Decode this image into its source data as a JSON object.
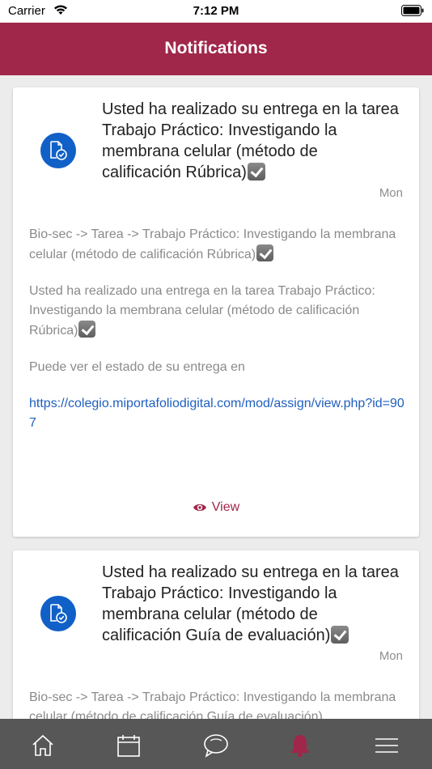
{
  "status_bar": {
    "carrier": "Carrier",
    "time": "7:12 PM"
  },
  "header": {
    "title": "Notifications"
  },
  "notifications": [
    {
      "subject": "Usted ha realizado su entrega en la tarea Trabajo Práctico: Investigando la membrana celular (método de calificación Rúbrica)",
      "time": "Mon",
      "body_line1": "Bio-sec -> Tarea -> Trabajo Práctico: Investigando la membrana celular (método de calificación Rúbrica)",
      "body_line2": "Usted ha realizado una entrega en la tarea Trabajo Práctico: Investigando la membrana celular (método de calificación Rúbrica)",
      "body_line3": "Puede ver el estado de su entrega en",
      "link": "https://colegio.miportafoliodigital.com/mod/assign/view.php?id=907",
      "view_label": "View"
    },
    {
      "subject": "Usted ha realizado su entrega en la tarea Trabajo Práctico: Investigando la membrana celular (método de calificación Guía de evaluación)",
      "time": "Mon",
      "body_line1": "Bio-sec -> Tarea -> Trabajo Práctico: Investigando la membrana celular (método de calificación Guía de evaluación)"
    }
  ],
  "tabs": [
    {
      "icon": "home-icon",
      "active": false
    },
    {
      "icon": "calendar-icon",
      "active": false
    },
    {
      "icon": "messages-icon",
      "active": false
    },
    {
      "icon": "bell-icon",
      "active": true
    },
    {
      "icon": "menu-icon",
      "active": false
    }
  ],
  "colors": {
    "header": "#a0264a",
    "accent": "#a0264a",
    "icon_circle": "#1060c8",
    "link": "#1f5fbf",
    "tabbar": "#575757"
  }
}
